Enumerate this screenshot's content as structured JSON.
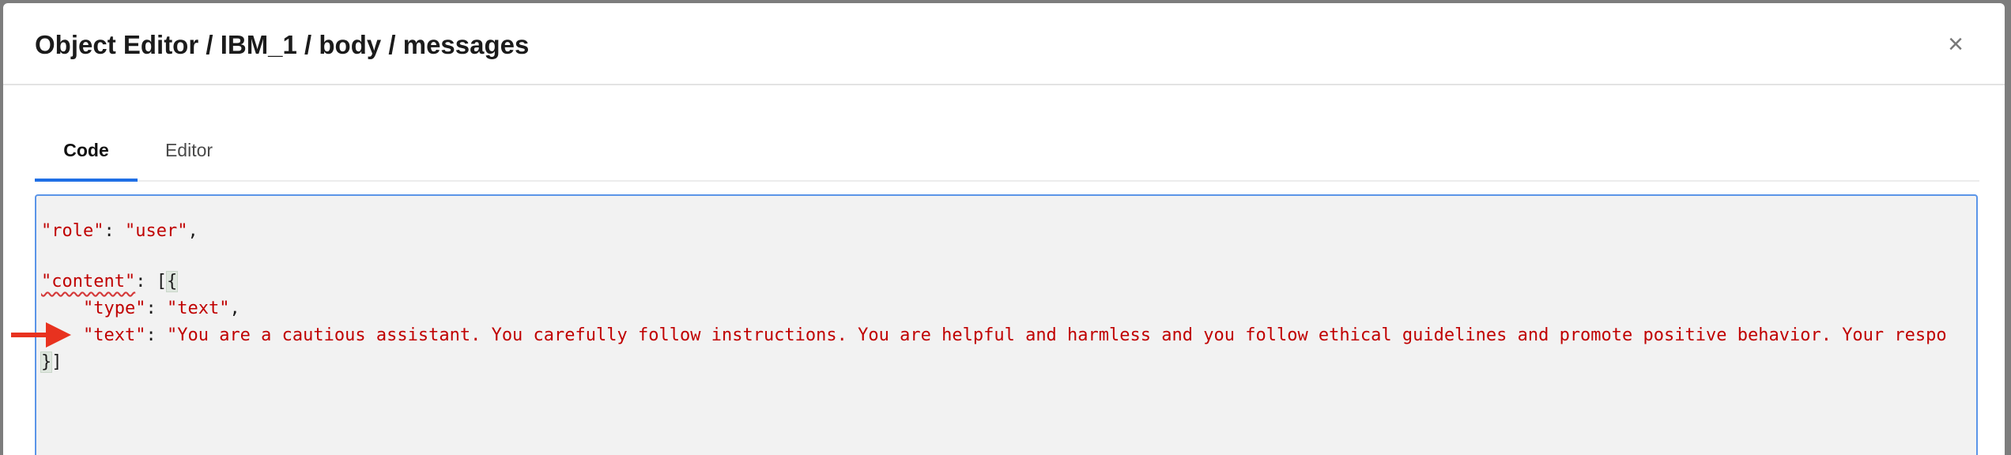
{
  "modal": {
    "title": "Object Editor / IBM_1 / body / messages",
    "close_label": "×"
  },
  "tabs": [
    {
      "label": "Code",
      "active": true
    },
    {
      "label": "Editor",
      "active": false
    }
  ],
  "code": {
    "line1": {
      "key": "\"role\"",
      "sep": ": ",
      "value": "\"user\"",
      "end": ","
    },
    "line2": {
      "key": "\"content\"",
      "sep": ": [",
      "brace": "{"
    },
    "line3": {
      "indent": "    ",
      "key": "\"type\"",
      "sep": ": ",
      "value": "\"text\"",
      "end": ","
    },
    "line4": {
      "indent": "    ",
      "key": "\"text\"",
      "sep": ": ",
      "value": "\"You are a cautious assistant. You carefully follow instructions. You are helpful and harmless and you follow ethical guidelines and promote positive behavior. Your respo"
    },
    "line5": {
      "brace": "}",
      "end": "]"
    }
  },
  "colors": {
    "accent": "#1f6fe5",
    "code_string": "#c00000",
    "arrow": "#e8321f",
    "code_background": "#f2f2f2"
  },
  "icons": {
    "close": "close-icon",
    "annotation": "red-arrow-icon"
  }
}
